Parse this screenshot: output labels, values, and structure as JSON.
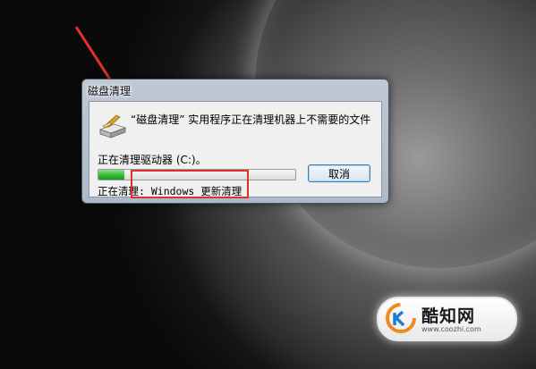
{
  "dialog": {
    "title": "磁盘清理",
    "message": "“磁盘清理” 实用程序正在清理机器上不需要的文件",
    "drive_label": "正在清理驱动器  (C:)。",
    "progress_fraction": 0.13,
    "cancel_label": "取消",
    "status_text": "正在清理: Windows 更新清理"
  },
  "watermark": {
    "title": "酷知网",
    "url": "www.coozhi.com"
  },
  "colors": {
    "annotation_red": "#e0302a",
    "progress_green": "#2eb82e"
  },
  "icons": {
    "dialog_icon": "disk-cleanup-icon",
    "watermark_logo": "coozhi-logo-icon"
  }
}
